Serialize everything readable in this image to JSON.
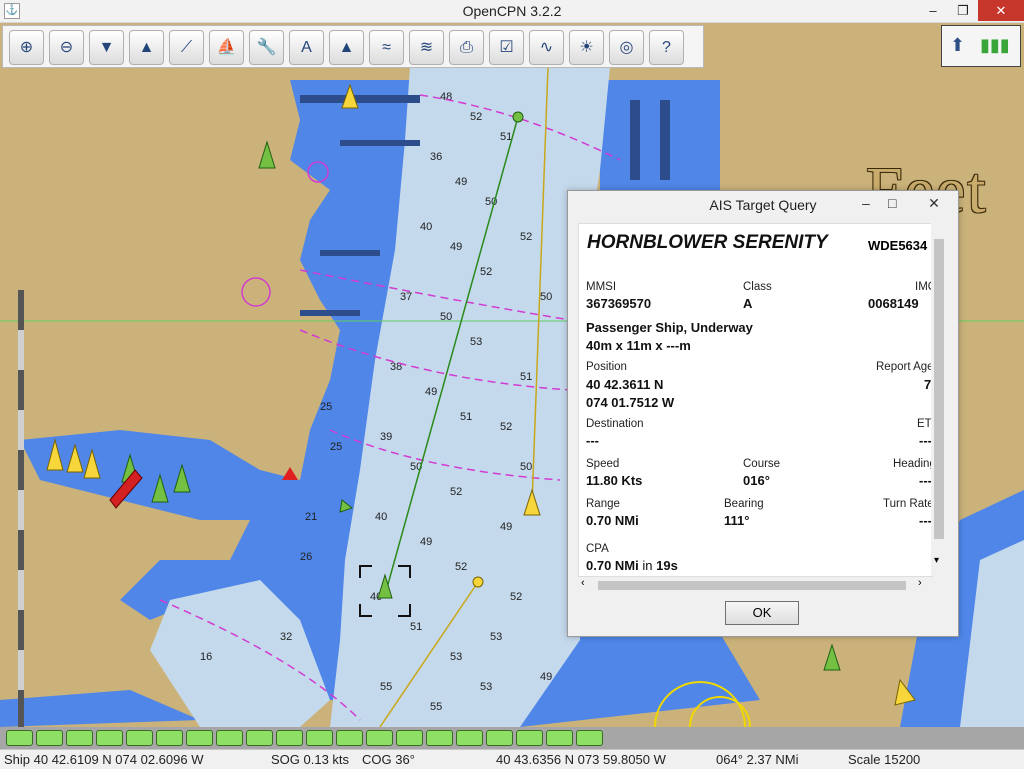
{
  "window": {
    "title": "OpenCPN 3.2.2",
    "minimize": "–",
    "maximize": "❐",
    "close": "✕"
  },
  "toolbar": [
    {
      "name": "zoom-in-icon",
      "glyph": "⊕"
    },
    {
      "name": "zoom-out-icon",
      "glyph": "⊖"
    },
    {
      "name": "scale-down-icon",
      "glyph": "▼"
    },
    {
      "name": "scale-up-icon",
      "glyph": "▲"
    },
    {
      "name": "route-icon",
      "glyph": "⟋"
    },
    {
      "name": "follow-ship-icon",
      "glyph": "⛵"
    },
    {
      "name": "options-wrench-icon",
      "glyph": "🔧"
    },
    {
      "name": "text-icon",
      "glyph": "A"
    },
    {
      "name": "ais-icon",
      "glyph": "▲"
    },
    {
      "name": "current-icon",
      "glyph": "≈"
    },
    {
      "name": "tide-icon",
      "glyph": "≋"
    },
    {
      "name": "print-icon",
      "glyph": "⎙"
    },
    {
      "name": "route-manager-icon",
      "glyph": "☑"
    },
    {
      "name": "track-icon",
      "glyph": "∿"
    },
    {
      "name": "color-scheme-icon",
      "glyph": "☀"
    },
    {
      "name": "mob-icon",
      "glyph": "◎"
    },
    {
      "name": "help-icon",
      "glyph": "?"
    }
  ],
  "status_tools": {
    "compass": "north-compass-icon",
    "signal": "gps-signal-icon"
  },
  "chart": {
    "units_overlay": "Feet"
  },
  "ais_dialog": {
    "title": "AIS Target Query",
    "ship_name": "HORNBLOWER SERENITY",
    "call_sign": "WDE5634",
    "mmsi_label": "MMSI",
    "mmsi": "367369570",
    "class_label": "Class",
    "class": "A",
    "imo_label": "IMO",
    "imo": "0068149",
    "type_status": "Passenger Ship, Underway",
    "dimensions": "40m x 11m x ---m",
    "position_label": "Position",
    "lat": "40 42.3611 N",
    "lon": "074 01.7512 W",
    "report_age_label": "Report Age",
    "report_age": "7",
    "destination_label": "Destination",
    "destination": "---",
    "eta_label": "ETA",
    "eta": "---",
    "speed_label": "Speed",
    "speed": "11.80 Kts",
    "course_label": "Course",
    "course": "016°",
    "heading_label": "Heading",
    "heading": "---",
    "range_label": "Range",
    "range": "0.70 NMi",
    "bearing_label": "Bearing",
    "bearing": "111°",
    "turn_rate_label": "Turn Rate",
    "turn_rate": "---",
    "cpa_label": "CPA",
    "cpa_dist": "0.70 NMi",
    "cpa_in": "in",
    "cpa_time": "19s",
    "ok_label": "OK"
  },
  "piano_keys": 20,
  "status": {
    "ship": "Ship 40 42.6109 N   074 02.6096 W",
    "sog": "SOG 0.13 kts",
    "cog": "COG 36°",
    "cursor": "40 43.6356 N   073 59.8050 W",
    "bearing_dist": "064°  2.37 NMi",
    "scale": "Scale 15200"
  },
  "colors": {
    "land": "#cbb27a",
    "shallow": "#4f86e8",
    "deep": "#c5d9ec",
    "ais_target": "#74c043",
    "ais_other": "#f6d63a"
  }
}
